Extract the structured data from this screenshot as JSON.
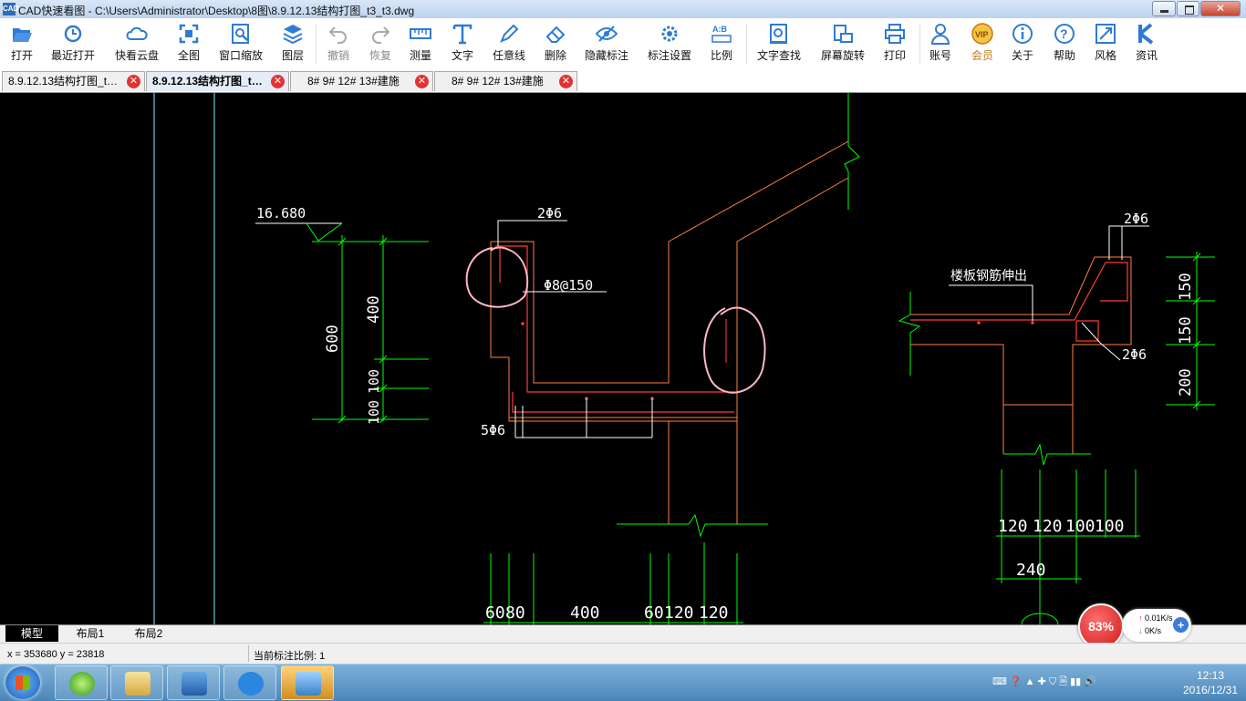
{
  "window": {
    "title": "CAD快速看图 - C:\\Users\\Administrator\\Desktop\\8图\\8.9.12.13结构打图_t3_t3.dwg",
    "app_icon_text": "CAD"
  },
  "toolbar": {
    "items": [
      {
        "label": "打开",
        "icon": "folder-open-icon"
      },
      {
        "label": "最近打开",
        "icon": "history-icon"
      },
      {
        "label": "快看云盘",
        "icon": "cloud-icon"
      },
      {
        "label": "全图",
        "icon": "fit-all-icon"
      },
      {
        "label": "窗口缩放",
        "icon": "window-zoom-icon"
      },
      {
        "label": "图层",
        "icon": "layers-icon"
      },
      {
        "label": "撤销",
        "icon": "undo-icon",
        "disabled": true
      },
      {
        "label": "恢复",
        "icon": "redo-icon",
        "disabled": true
      },
      {
        "label": "测量",
        "icon": "measure-icon"
      },
      {
        "label": "文字",
        "icon": "text-icon"
      },
      {
        "label": "任意线",
        "icon": "pen-icon"
      },
      {
        "label": "删除",
        "icon": "eraser-icon"
      },
      {
        "label": "隐藏标注",
        "icon": "hide-eye-icon"
      },
      {
        "label": "标注设置",
        "icon": "annotation-settings-icon"
      },
      {
        "label": "比例",
        "icon": "scale-icon"
      },
      {
        "label": "文字查找",
        "icon": "text-search-icon"
      },
      {
        "label": "屏幕旋转",
        "icon": "screen-rotate-icon"
      },
      {
        "label": "打印",
        "icon": "printer-icon"
      },
      {
        "label": "账号",
        "icon": "user-icon"
      },
      {
        "label": "会员",
        "icon": "vip-icon"
      },
      {
        "label": "关于",
        "icon": "info-icon"
      },
      {
        "label": "帮助",
        "icon": "help-icon"
      },
      {
        "label": "风格",
        "icon": "style-icon"
      },
      {
        "label": "资讯",
        "icon": "news-icon"
      }
    ]
  },
  "tabs": [
    {
      "label": "8.9.12.13结构打图_t…",
      "active": false
    },
    {
      "label": "8.9.12.13结构打图_t…",
      "active": true
    },
    {
      "label": "8# 9# 12# 13#建施",
      "active": false
    },
    {
      "label": "8# 9# 12# 13#建施",
      "active": false
    }
  ],
  "drawing": {
    "elev": "16.680",
    "dim_600": "600",
    "dim_400": "400",
    "dim_100a": "100",
    "dim_100b": "100",
    "rebar_2phi6_left": "2Φ6",
    "rebar_phi8": "Φ8@150",
    "rebar_5phi6": "5Φ6",
    "bottom_dims": [
      "60",
      "80",
      "400",
      "60",
      "120",
      "120"
    ],
    "right_note": "楼板钢筋伸出",
    "rebar_2phi6_right_top": "2Φ6",
    "rebar_2phi6_right_bottom": "2Φ6",
    "right_dims_vertical": [
      "150",
      "150",
      "200"
    ],
    "right_dims_bottom": [
      "120",
      "120",
      "100",
      "100"
    ],
    "right_dim_240": "240",
    "colors": {
      "green": "#00ff00",
      "red": "#ff3b3b",
      "orange": "#ff7f3f",
      "pink": "#ffb6c8",
      "cyan": "#7ff0ff"
    }
  },
  "layout_tabs": [
    "模型",
    "布局1",
    "布局2"
  ],
  "status": {
    "coords": "x = 353680  y = 23818",
    "scale": "当前标注比例: 1"
  },
  "net": {
    "percent": "83%",
    "up": "0.01K/s",
    "down": "0K/s"
  },
  "clock": {
    "time": "12:13",
    "date": "2016/12/31"
  }
}
